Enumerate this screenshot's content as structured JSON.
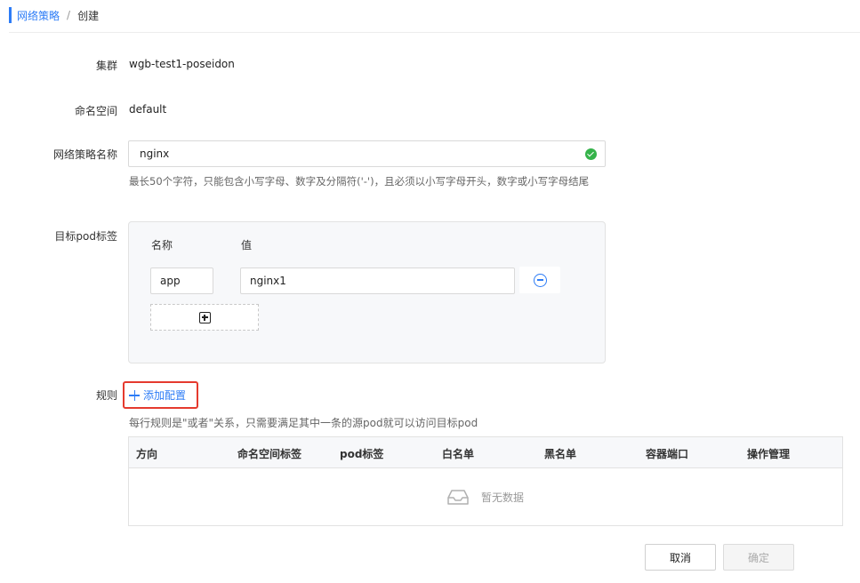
{
  "breadcrumb": {
    "parent": "网络策略",
    "separator": "/",
    "current": "创建"
  },
  "form": {
    "cluster": {
      "label": "集群",
      "value": "wgb-test1-poseidon"
    },
    "namespace": {
      "label": "命名空间",
      "value": "default"
    },
    "policy_name": {
      "label": "网络策略名称",
      "value": "nginx",
      "status_icon": "check-circle-icon",
      "hint": "最长50个字符，只能包含小写字母、数字及分隔符('-')，且必须以小写字母开头，数字或小写字母结尾"
    },
    "pod_labels": {
      "label": "目标pod标签",
      "col_name": "名称",
      "col_value": "值",
      "rows": [
        {
          "key": "app",
          "value": "nginx1"
        }
      ]
    },
    "rules": {
      "label": "规则",
      "add_label": "添加配置",
      "hint": "每行规则是\"或者\"关系，只需要满足其中一条的源pod就可以访问目标pod",
      "columns": [
        "方向",
        "命名空间标签",
        "pod标签",
        "白名单",
        "黑名单",
        "容器端口",
        "操作管理"
      ],
      "empty_text": "暂无数据"
    }
  },
  "actions": {
    "cancel": "取消",
    "confirm": "确定"
  },
  "colors": {
    "primary": "#2d7cf6",
    "success": "#35b34a",
    "highlight": "#e53a2e"
  }
}
